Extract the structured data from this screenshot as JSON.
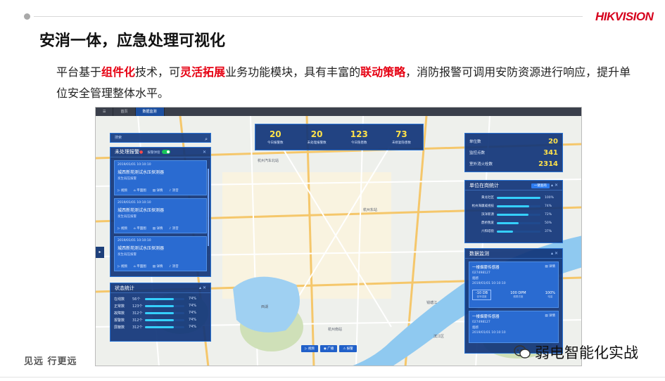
{
  "header": {
    "brand": "HIKVISION",
    "title": "安消一体，应急处理可视化"
  },
  "body": {
    "p1": "平台基于",
    "h1": "组件化",
    "p2": "技术，可",
    "h2": "灵活拓展",
    "p3": "业务功能模块，具有丰富的",
    "h3": "联动策略",
    "p4": "，消防报警可调用安防资源进行响应，提升单位安全管理整体水平。"
  },
  "footer": {
    "slogan": "见远 行更远",
    "watermark": "弱电智能化实战"
  },
  "colors": {
    "accent": "#e60012",
    "panel": "#10347a",
    "highlight_num": "#ffe24a"
  },
  "screen": {
    "tabs": [
      {
        "label": "首页"
      },
      {
        "label": "数据监测"
      }
    ],
    "search_placeholder": "搜索",
    "alarm": {
      "title": "未处理报警",
      "toggle_label": "报警弹窗",
      "cards": [
        {
          "time": "2019/01/01 10:10:10",
          "name": "城西新苑测试水压探测器",
          "status": "发生弱压报警",
          "actions": [
            "视频",
            "平面图",
            "详情",
            "消音"
          ]
        },
        {
          "time": "2019/01/01 10:10:10",
          "name": "城西新苑测试水压探测器",
          "status": "发生弱压报警",
          "actions": [
            "视频",
            "平面图",
            "详情",
            "消音"
          ]
        },
        {
          "time": "2019/01/01 10:10:10",
          "name": "城西新苑测试水压探测器",
          "status": "发生弱压报警",
          "actions": [
            "视频",
            "平面图",
            "详情",
            "消音"
          ]
        }
      ]
    },
    "status": {
      "title": "状态统计",
      "rows": [
        {
          "label": "在线数",
          "count": "56个",
          "pct": "74%",
          "ratio": 0.74
        },
        {
          "label": "正常数",
          "count": "123个",
          "pct": "74%",
          "ratio": 0.74
        },
        {
          "label": "故障数",
          "count": "312个",
          "pct": "74%",
          "ratio": 0.74
        },
        {
          "label": "报警数",
          "count": "312个",
          "pct": "74%",
          "ratio": 0.74
        },
        {
          "label": "屏蔽数",
          "count": "312个",
          "pct": "74%",
          "ratio": 0.74
        }
      ]
    },
    "top_stats": [
      {
        "value": "20",
        "label": "今日报警数"
      },
      {
        "value": "20",
        "label": "未处理报警数"
      },
      {
        "value": "123",
        "label": "今日隐患数"
      },
      {
        "value": "73",
        "label": "未修复隐患数"
      }
    ],
    "units": [
      {
        "label": "单位数",
        "value": "20"
      },
      {
        "label": "监控点数",
        "value": "341"
      },
      {
        "label": "室外消火栓数",
        "value": "2314"
      }
    ],
    "online": {
      "title": "单位在岗统计",
      "button": "一键查岗",
      "rows": [
        {
          "label": "黄龙社区",
          "pct": "100%",
          "ratio": 1.0
        },
        {
          "label": "杭州海康威视技",
          "pct": "74%",
          "ratio": 0.74
        },
        {
          "label": "滨洋新源",
          "pct": "72%",
          "ratio": 0.72
        },
        {
          "label": "鼎桥我爱",
          "pct": "50%",
          "ratio": 0.5
        },
        {
          "label": "六和塔街",
          "pct": "37%",
          "ratio": 0.37
        }
      ]
    },
    "monitor": {
      "title": "数据监测",
      "cards": [
        {
          "name": "一楼烟雾传感器",
          "id": "027498127",
          "state": "烟感",
          "time": "2019/01/01 10:10:10",
          "details": "详情",
          "metrics": [
            {
              "v": "-10 DB",
              "u": "信号强度"
            },
            {
              "v": "100 DPM",
              "u": "烟雾浓度"
            },
            {
              "v": "100%",
              "u": "电量"
            }
          ]
        },
        {
          "name": "一楼烟雾传感器",
          "id": "027498127",
          "state": "烟感",
          "time": "2019/01/01 10:10:10",
          "details": "详情"
        }
      ]
    },
    "bottom_buttons": [
      "视频",
      "广播",
      "报警"
    ],
    "map_labels": [
      "杭州东站",
      "杭州汽车北站",
      "西湖",
      "钱塘江",
      "滨江区",
      "杭州南站"
    ]
  }
}
